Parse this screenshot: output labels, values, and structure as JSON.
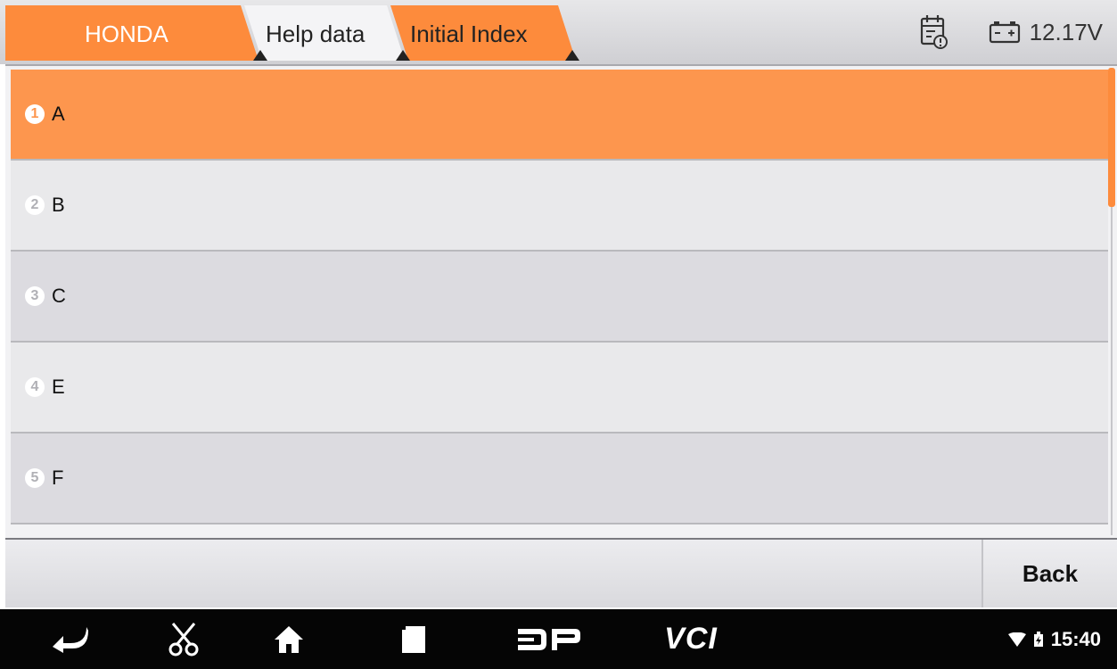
{
  "breadcrumb": {
    "items": [
      {
        "label": "HONDA"
      },
      {
        "label": "Help data"
      },
      {
        "label": "Initial Index"
      }
    ]
  },
  "status": {
    "report_icon": "report-calendar-icon",
    "battery_icon": "car-battery-icon",
    "voltage": "12.17V"
  },
  "list": {
    "items": [
      {
        "number": "1",
        "label": "A",
        "selected": true
      },
      {
        "number": "2",
        "label": "B",
        "selected": false
      },
      {
        "number": "3",
        "label": "C",
        "selected": false
      },
      {
        "number": "4",
        "label": "E",
        "selected": false
      },
      {
        "number": "5",
        "label": "F",
        "selected": false
      }
    ]
  },
  "actions": {
    "back_label": "Back"
  },
  "navbar": {
    "icons": [
      "back-arrow-icon",
      "scissors-icon",
      "home-icon",
      "recent-apps-icon",
      "dp-logo-icon",
      "vci-logo-icon"
    ],
    "vci_label": "VCI",
    "time": "15:40"
  },
  "colors": {
    "accent": "#fd964e",
    "scroll_thumb": "#fd8b3c",
    "row_light": "#e9e9eb",
    "row_dark": "#dcdbe0",
    "navbar": "#050505"
  }
}
